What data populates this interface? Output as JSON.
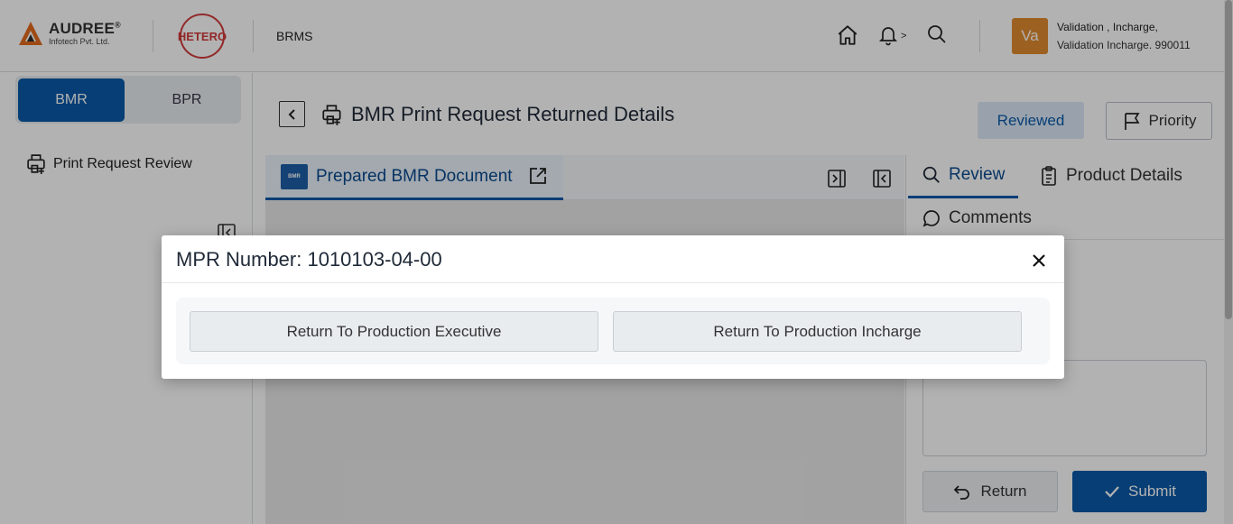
{
  "header": {
    "brand_name": "AUDREE",
    "brand_reg": "®",
    "brand_sub": "Infotech Pvt. Ltd.",
    "client_logo_text": "HETERO",
    "app_name": "BRMS",
    "notification_indicator": ">",
    "user_initials": "Va",
    "user_line1": "Validation , Incharge,",
    "user_line2": "Validation Incharge. 990011",
    "avatar_color": "#e08a2e"
  },
  "sidebar": {
    "toggle": [
      "BMR",
      "BPR"
    ],
    "active_toggle": "BMR",
    "items": [
      {
        "label": "Print Request Review",
        "icon": "printer-icon"
      }
    ]
  },
  "main": {
    "title": "BMR Print Request Returned Details",
    "status_button": "Reviewed",
    "priority_button": "Priority",
    "doc_tab_badge": "BMR",
    "doc_tab_label": "Prepared BMR Document",
    "right_tabs": [
      {
        "label": "Review",
        "icon": "search-icon",
        "active": true
      },
      {
        "label": "Product Details",
        "icon": "clipboard-icon",
        "active": false
      },
      {
        "label": "Comments",
        "icon": "comment-icon",
        "active": false
      }
    ],
    "return_button": "Return",
    "submit_button": "Submit"
  },
  "modal": {
    "title": "MPR Number: 1010103-04-00",
    "buttons": [
      "Return To Production Executive",
      "Return To Production Incharge"
    ]
  },
  "colors": {
    "primary": "#0a59a8",
    "reviewed_bg": "#dbe9f7",
    "brand_red": "#d23b3b",
    "brand_orange": "#e36a1e"
  }
}
